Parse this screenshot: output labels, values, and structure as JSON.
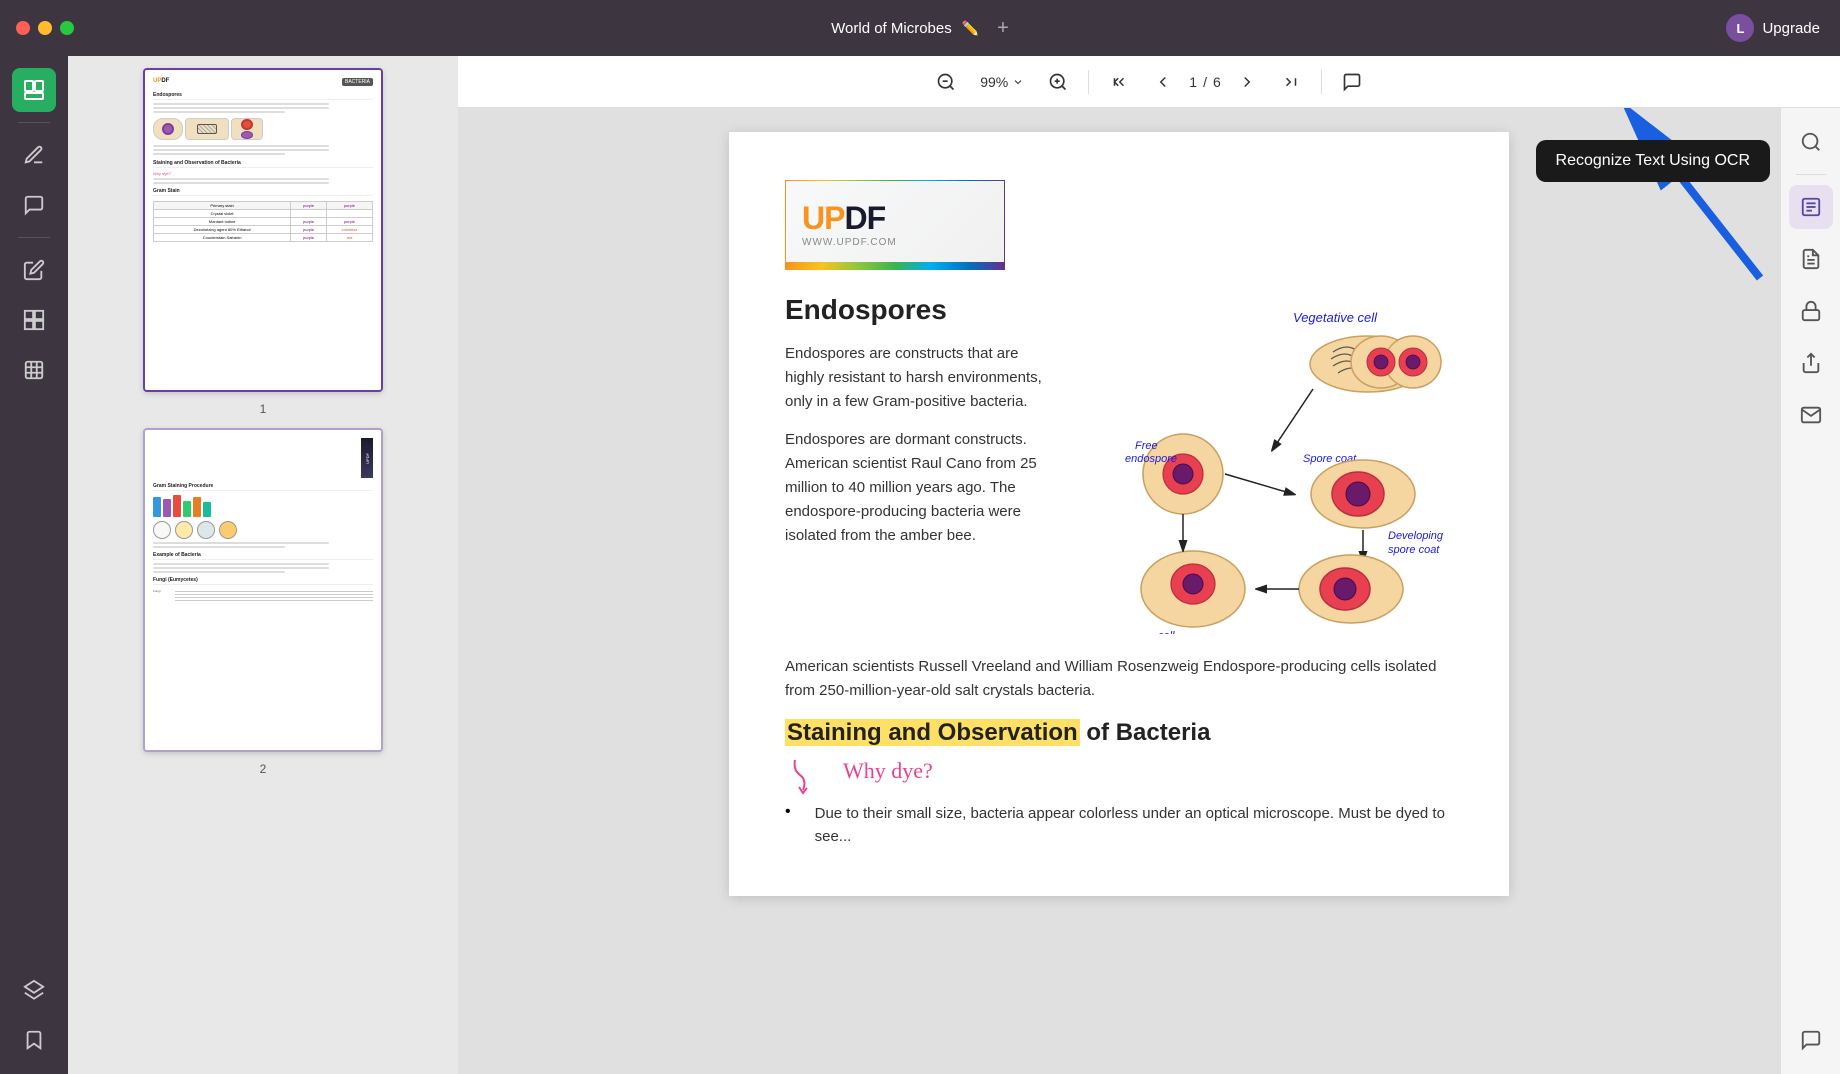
{
  "titleBar": {
    "title": "World of Microbes",
    "upgradeLabel": "Upgrade",
    "avatarLetter": "L"
  },
  "toolbar": {
    "zoomLevel": "99%",
    "currentPage": "1",
    "totalPages": "6"
  },
  "leftSidebar": {
    "icons": [
      "📄",
      "✏️",
      "📝",
      "🔖",
      "📋",
      "📦",
      "🔖"
    ]
  },
  "ocrTooltip": {
    "text": "Recognize Text Using OCR"
  },
  "rightTools": {
    "searchLabel": "Search",
    "ocrLabel": "OCR",
    "convertLabel": "Convert PDF",
    "secureLabel": "Secure",
    "shareLabel": "Share",
    "emailLabel": "Email",
    "commentLabel": "Comment"
  },
  "pdfContent": {
    "logoText": "UPDF",
    "logoUrl": "WWW.UPDF.COM",
    "endosporesTitle": "Endospores",
    "para1": "Endospores are constructs that are highly resistant to harsh environments, only in a few Gram-positive bacteria.",
    "para2": "Endospores are dormant constructs. American scientist Raul Cano from 25 million to 40 million years ago. The endospore-producing bacteria were isolated from the amber bee.",
    "para3": "American scientists Russell Vreeland and William Rosenzweig Endospore-producing cells isolated from 250-million-year-old salt crystals bacteria.",
    "stainingTitlePart1": "Staining and Observation",
    "stainingTitlePart2": " of Bacteria",
    "whyDye": "Why dye?",
    "bulletText": "Due to their small size, bacteria appear colorless under an optical microscope. Must be dyed to see...",
    "diagramLabels": {
      "vegetativeCell": "Vegetative cell",
      "freeEndospore": "Free endospore",
      "sporeCoat": "Spore coat",
      "developingSporeCoat": "Developing spore coat",
      "motherCell": "Mother cell"
    }
  },
  "thumbnails": [
    {
      "pageNum": "1",
      "selected": true
    },
    {
      "pageNum": "2",
      "selected": false
    }
  ]
}
